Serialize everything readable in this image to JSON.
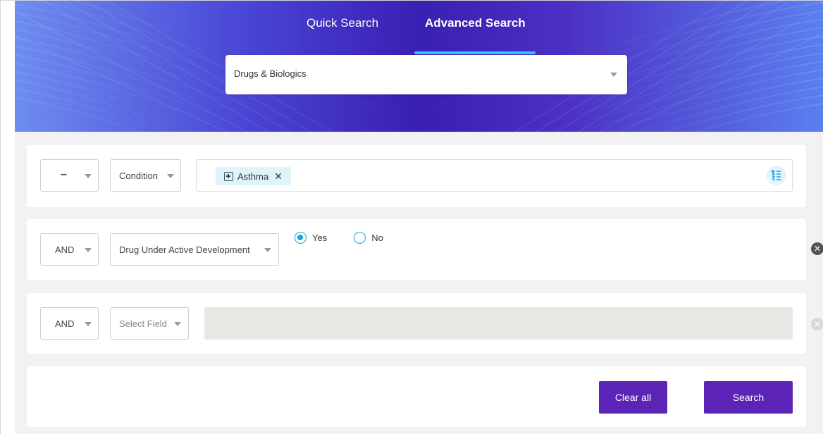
{
  "tabs": [
    {
      "label": "Quick Search",
      "active": false
    },
    {
      "label": "Advanced Search",
      "active": true
    }
  ],
  "category_select": {
    "value": "Drugs & Biologics"
  },
  "rows": [
    {
      "operator": "–",
      "field": "Condition",
      "chips": [
        {
          "label": "Asthma"
        }
      ],
      "tree_icon": "hierarchy-tree-icon"
    },
    {
      "operator": "AND",
      "field": "Drug Under Active Development",
      "radio_options": [
        {
          "label": "Yes",
          "selected": true
        },
        {
          "label": "No",
          "selected": false
        }
      ]
    },
    {
      "operator": "AND",
      "field_placeholder": "Select Field"
    }
  ],
  "actions": {
    "clear_label": "Clear all",
    "search_label": "Search"
  },
  "colors": {
    "primary_button": "#5b24b6",
    "accent": "#2cc7ff",
    "radio": "#1aa4d8",
    "chip_bg": "#dff3fb"
  }
}
